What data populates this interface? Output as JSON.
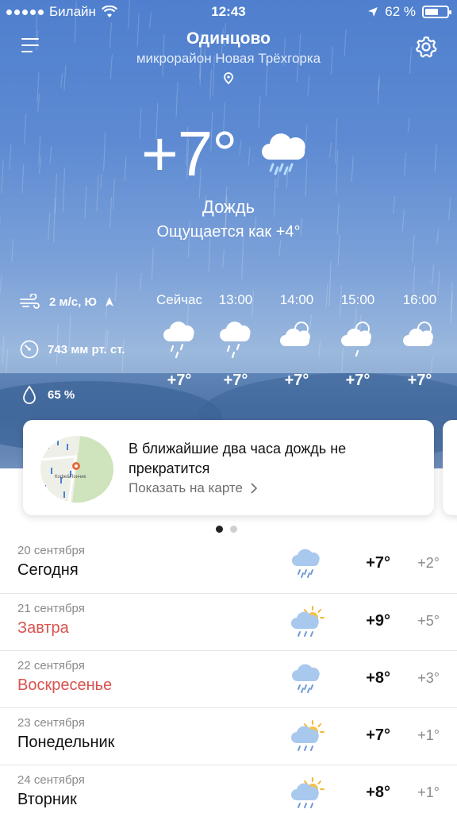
{
  "status_bar": {
    "carrier": "Билайн",
    "time": "12:43",
    "battery": "62 %",
    "battery_level": 0.62
  },
  "location": {
    "city": "Одинцово",
    "district": "микрорайон Новая Трёхгорка"
  },
  "current": {
    "temperature": "+7°",
    "condition": "Дождь",
    "feels_like": "Ощущается как +4°",
    "icon": "cloud-rain-icon",
    "wind": "2 м/с, Ю",
    "pressure": "743 мм рт. ст.",
    "humidity": "65 %"
  },
  "hourly": [
    {
      "label": "Сейчас",
      "temp": "+7°",
      "icon": "cloud-rain-icon"
    },
    {
      "label": "13:00",
      "temp": "+7°",
      "icon": "cloud-rain-icon"
    },
    {
      "label": "14:00",
      "temp": "+7°",
      "icon": "partly-cloudy-icon"
    },
    {
      "label": "15:00",
      "temp": "+7°",
      "icon": "partly-cloudy-rain-icon"
    },
    {
      "label": "16:00",
      "temp": "+7°",
      "icon": "partly-cloudy-icon"
    }
  ],
  "nowcast_card": {
    "title": "В ближайшие два часа дождь не прекратится",
    "link": "Показать на карте",
    "map_label": "Кофе&Пончик"
  },
  "daily": [
    {
      "date": "20 сентября",
      "day": "Сегодня",
      "weekend": false,
      "high": "+7°",
      "low": "+2°",
      "icon": "cloud-rain-icon"
    },
    {
      "date": "21 сентября",
      "day": "Завтра",
      "weekend": true,
      "high": "+9°",
      "low": "+5°",
      "icon": "sun-cloud-rain-icon"
    },
    {
      "date": "22 сентября",
      "day": "Воскресенье",
      "weekend": true,
      "high": "+8°",
      "low": "+3°",
      "icon": "cloud-rain-icon"
    },
    {
      "date": "23 сентября",
      "day": "Понедельник",
      "weekend": false,
      "high": "+7°",
      "low": "+1°",
      "icon": "sun-cloud-rain-icon"
    },
    {
      "date": "24 сентября",
      "day": "Вторник",
      "weekend": false,
      "high": "+8°",
      "low": "+1°",
      "icon": "sun-cloud-rain-icon"
    }
  ],
  "colors": {
    "sky": "#5d8ad2",
    "weekend_red": "#d9534f",
    "muted": "#8a8a8a"
  }
}
